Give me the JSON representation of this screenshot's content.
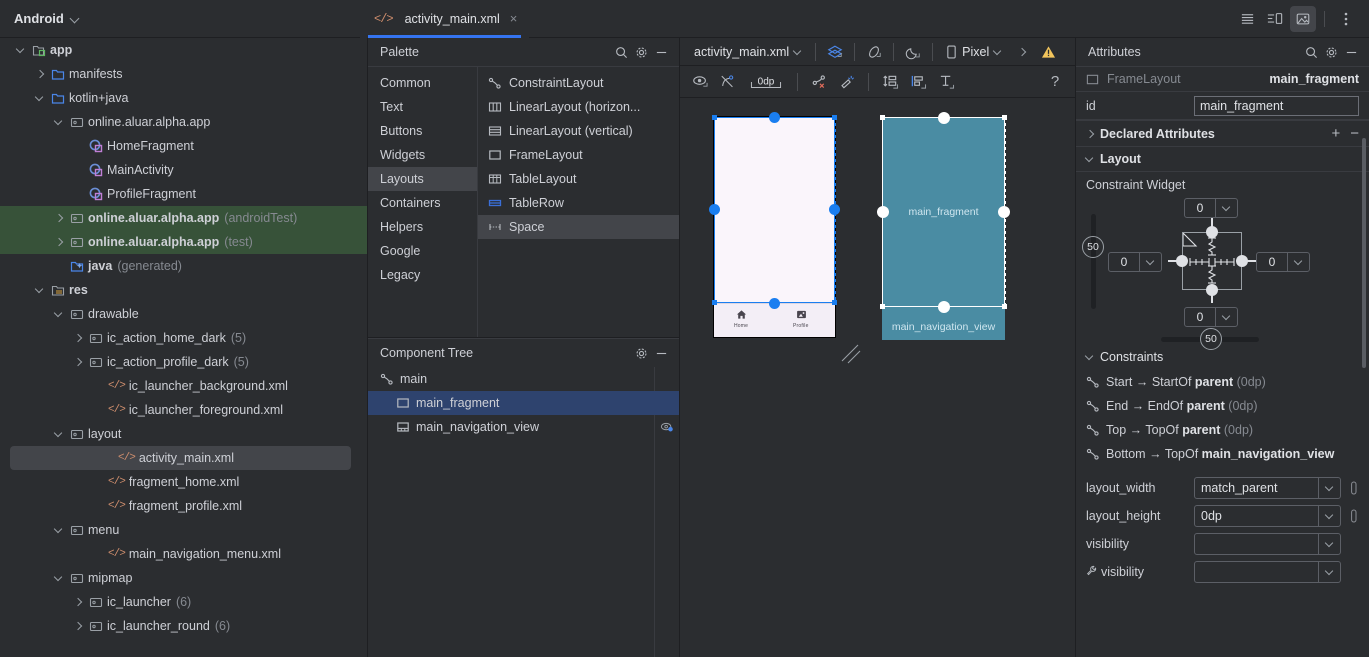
{
  "window": {
    "project_selector": "Android",
    "right_icons": [
      "list-icon",
      "split-layout-icon",
      "image-preview-icon",
      "more-options-icon"
    ]
  },
  "editor_tabs": [
    {
      "label": "activity_main.xml",
      "icon": "xml-file-icon",
      "active": true,
      "close": "×"
    }
  ],
  "project_tree": {
    "items": [
      {
        "label": "app",
        "indent": 0,
        "arrow": "down",
        "icon": "module",
        "bold": true,
        "suffix": ""
      },
      {
        "label": "manifests",
        "indent": 1,
        "arrow": "right",
        "icon": "folder",
        "bold": false,
        "suffix": ""
      },
      {
        "label": "kotlin+java",
        "indent": 1,
        "arrow": "down",
        "icon": "folder",
        "bold": false,
        "suffix": ""
      },
      {
        "label": "online.aluar.alpha.app",
        "indent": 2,
        "arrow": "down",
        "icon": "package",
        "bold": false,
        "suffix": ""
      },
      {
        "label": "HomeFragment",
        "indent": 3,
        "arrow": "none",
        "icon": "kotlin",
        "bold": false,
        "suffix": ""
      },
      {
        "label": "MainActivity",
        "indent": 3,
        "arrow": "none",
        "icon": "kotlin",
        "bold": false,
        "suffix": ""
      },
      {
        "label": "ProfileFragment",
        "indent": 3,
        "arrow": "none",
        "icon": "kotlin",
        "bold": false,
        "suffix": ""
      },
      {
        "label": "online.aluar.alpha.app",
        "indent": 2,
        "arrow": "right",
        "icon": "package",
        "bold": true,
        "suffix": "(androidTest)",
        "highlight": "green"
      },
      {
        "label": "online.aluar.alpha.app",
        "indent": 2,
        "arrow": "right",
        "icon": "package",
        "bold": true,
        "suffix": "(test)",
        "highlight": "green"
      },
      {
        "label": "java",
        "indent": 2,
        "arrow": "none",
        "icon": "folder-gen",
        "bold": true,
        "suffix": "(generated)"
      },
      {
        "label": "res",
        "indent": 1,
        "arrow": "down",
        "icon": "res-folder",
        "bold": true,
        "suffix": ""
      },
      {
        "label": "drawable",
        "indent": 2,
        "arrow": "down",
        "icon": "package",
        "bold": false,
        "suffix": ""
      },
      {
        "label": "ic_action_home_dark",
        "indent": 3,
        "arrow": "right",
        "icon": "package",
        "bold": false,
        "suffix": "(5)"
      },
      {
        "label": "ic_action_profile_dark",
        "indent": 3,
        "arrow": "right",
        "icon": "package",
        "bold": false,
        "suffix": "(5)"
      },
      {
        "label": "ic_launcher_background.xml",
        "indent": 4,
        "arrow": "none",
        "icon": "xml",
        "bold": false,
        "suffix": ""
      },
      {
        "label": "ic_launcher_foreground.xml",
        "indent": 4,
        "arrow": "none",
        "icon": "xml",
        "bold": false,
        "suffix": ""
      },
      {
        "label": "layout",
        "indent": 2,
        "arrow": "down",
        "icon": "package",
        "bold": false,
        "suffix": ""
      },
      {
        "label": "activity_main.xml",
        "indent": 4,
        "arrow": "none",
        "icon": "xml",
        "bold": false,
        "suffix": "",
        "highlight": "selected"
      },
      {
        "label": "fragment_home.xml",
        "indent": 4,
        "arrow": "none",
        "icon": "xml",
        "bold": false,
        "suffix": ""
      },
      {
        "label": "fragment_profile.xml",
        "indent": 4,
        "arrow": "none",
        "icon": "xml",
        "bold": false,
        "suffix": ""
      },
      {
        "label": "menu",
        "indent": 2,
        "arrow": "down",
        "icon": "package",
        "bold": false,
        "suffix": ""
      },
      {
        "label": "main_navigation_menu.xml",
        "indent": 4,
        "arrow": "none",
        "icon": "xml",
        "bold": false,
        "suffix": ""
      },
      {
        "label": "mipmap",
        "indent": 2,
        "arrow": "down",
        "icon": "package",
        "bold": false,
        "suffix": ""
      },
      {
        "label": "ic_launcher",
        "indent": 3,
        "arrow": "right",
        "icon": "package",
        "bold": false,
        "suffix": "(6)"
      },
      {
        "label": "ic_launcher_round",
        "indent": 3,
        "arrow": "right",
        "icon": "package",
        "bold": false,
        "suffix": "(6)"
      }
    ]
  },
  "palette": {
    "title": "Palette",
    "categories": [
      "Common",
      "Text",
      "Buttons",
      "Widgets",
      "Layouts",
      "Containers",
      "Helpers",
      "Google",
      "Legacy"
    ],
    "selected_category": "Layouts",
    "items": [
      {
        "label": "ConstraintLayout",
        "icon": "constraint-layout-icon"
      },
      {
        "label": "LinearLayout (horizon...",
        "icon": "linear-layout-horizontal-icon"
      },
      {
        "label": "LinearLayout (vertical)",
        "icon": "linear-layout-vertical-icon"
      },
      {
        "label": "FrameLayout",
        "icon": "frame-layout-icon"
      },
      {
        "label": "TableLayout",
        "icon": "table-layout-icon"
      },
      {
        "label": "TableRow",
        "icon": "table-row-icon"
      },
      {
        "label": "Space",
        "icon": "space-icon"
      }
    ],
    "selected_item": "Space"
  },
  "component_tree": {
    "title": "Component Tree",
    "nodes": [
      {
        "label": "main",
        "indent": 0,
        "icon": "constraint-layout-icon",
        "selected": false,
        "eye": false
      },
      {
        "label": "main_fragment",
        "indent": 1,
        "icon": "frame-layout-icon",
        "selected": true,
        "eye": false
      },
      {
        "label": "main_navigation_view",
        "indent": 1,
        "icon": "bottom-nav-icon",
        "selected": false,
        "eye": true
      }
    ]
  },
  "design_toolbar": {
    "file_dropdown": "activity_main.xml",
    "device_dropdown": "Pixel",
    "margin_value": "0dp",
    "icons_row1": [
      "design-surface-icon",
      "orientation-icon",
      "night-mode-icon",
      "device-icon",
      "chevron-right-icon",
      "warning-icon"
    ],
    "icons_row2": [
      "eye-icon",
      "hide-constraints-icon",
      "margin-icon",
      "clear-constraints-icon",
      "infer-constraints-icon",
      "pack-icon",
      "align-icon",
      "guideline-icon"
    ],
    "help": "?"
  },
  "canvas": {
    "blueprint_labels": [
      "main_fragment",
      "main_navigation_view"
    ],
    "bottom_nav_items": [
      "Home",
      "Profile"
    ]
  },
  "attributes": {
    "title": "Attributes",
    "element_type": "FrameLayout",
    "element_id": "main_fragment",
    "id_label": "id",
    "id_value": "main_fragment",
    "declared_attributes": "Declared Attributes",
    "layout_section": "Layout",
    "constraint_widget_label": "Constraint Widget",
    "constraint_widget": {
      "top": "0",
      "left": "0",
      "right": "0",
      "bottom": "0",
      "vertical_bias": "50",
      "horizontal_bias": "50"
    },
    "constraints_section": "Constraints",
    "constraints": [
      {
        "from": "Start",
        "rel": "→ StartOf",
        "target": "parent",
        "dim": "(0dp)"
      },
      {
        "from": "End",
        "rel": "→ EndOf",
        "target": "parent",
        "dim": "(0dp)"
      },
      {
        "from": "Top",
        "rel": "→ TopOf",
        "target": "parent",
        "dim": "(0dp)"
      },
      {
        "from": "Bottom",
        "rel": "→ TopOf",
        "target": "main_navigation_view",
        "dim": ""
      }
    ],
    "fields": [
      {
        "label": "layout_width",
        "value": "match_parent",
        "wrench": false,
        "link": true
      },
      {
        "label": "layout_height",
        "value": "0dp",
        "wrench": false,
        "link": true
      },
      {
        "label": "visibility",
        "value": "",
        "wrench": false,
        "link": false
      },
      {
        "label": "visibility",
        "value": "",
        "wrench": true,
        "link": false
      }
    ]
  },
  "colors": {
    "bg": "#2b2d30",
    "accent": "#3574f0",
    "selection": "#2e436e",
    "green_row": "#375239",
    "blueprint": "#4a8ca3",
    "xml_icon": "#cf8e6d",
    "warning": "#f2c55c"
  }
}
